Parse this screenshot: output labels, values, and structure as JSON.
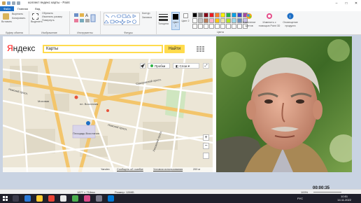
{
  "window": {
    "title": "коллект яндекс карты - Paint"
  },
  "menu": {
    "tabs": [
      "Файл",
      "Главная",
      "Вид"
    ]
  },
  "ribbon": {
    "groups": {
      "clipboard": {
        "label": "Буфер обмена",
        "paste": "Вставить",
        "cut": "Вырезать",
        "copy": "Копировать"
      },
      "image": {
        "label": "Изображение",
        "select": "Выделить",
        "crop": "Обрезать",
        "resize": "Изменить размер",
        "rotate": "Повернуть"
      },
      "tools": {
        "label": "Инструменты"
      },
      "shapes": {
        "label": "Фигуры",
        "outline": "Контур",
        "fill": "Заливка"
      },
      "thickness": "Толщина",
      "color1": "Цвет 1",
      "color2": "Цвет 2",
      "colors": {
        "label": "Цвета",
        "edit": "Изменение цветов",
        "paint3d": "Изменить с помощью Paint 3D",
        "alert": "Оповещение продукта"
      }
    },
    "palette": [
      "#000000",
      "#7f7f7f",
      "#880015",
      "#ed1c24",
      "#ff7f27",
      "#fff200",
      "#22b14c",
      "#00a2e8",
      "#3f48cc",
      "#a349a4",
      "#ffffff",
      "#c3c3c3",
      "#b97a57",
      "#ffaec9",
      "#ffc90e",
      "#efe4b0",
      "#b5e61d",
      "#99d9ea",
      "#7092be",
      "#c8bfe7",
      "#ffffff",
      "#ffffff",
      "#ffffff",
      "#ffffff",
      "#ffffff",
      "#ffffff",
      "#ffffff",
      "#ffffff",
      "#ffffff",
      "#ffffff"
    ]
  },
  "yandex": {
    "logo_y": "Я",
    "logo_rest": "ндекс",
    "search_value": "Карты",
    "search_button": "Найти"
  },
  "map": {
    "traffic": "Пробки",
    "layers": "Слои",
    "labels": [
      "Невский просп.",
      "Моховая",
      "пл. Восстания",
      "Площадь Восстания",
      "Суворовский просп.",
      "Лиговский просп.",
      "Невский просп."
    ],
    "footer_left": "Yandex",
    "footer_middle": "Сообщить об ошибке",
    "footer_right": "Условия использования",
    "scale": "200 м"
  },
  "status": {
    "size": "1877 × 716пкс",
    "file_size": "Размер: 126КБ",
    "zoom": "100%"
  },
  "recording": "00:00:35",
  "clock": {
    "time": "10:51",
    "date": "14.11.2022"
  },
  "lang": "РУС"
}
